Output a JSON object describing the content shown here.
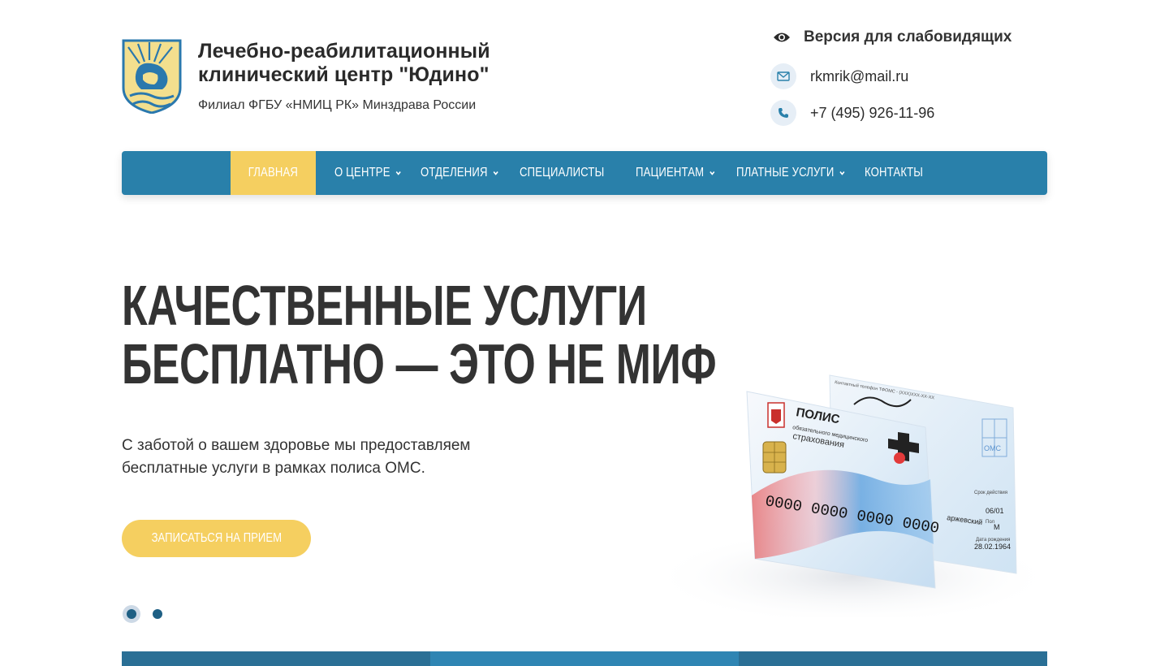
{
  "header": {
    "org_name_line1": "Лечебно-реабилитационный",
    "org_name_line2": "клинический центр \"Юдино\"",
    "org_subtitle": "Филиал ФГБУ «НМИЦ РК» Минздрава России",
    "vision_label": "Версия для слабовидящих",
    "vision_icon": "eye-icon",
    "email": "rkmrik@mail.ru",
    "email_icon": "envelope-icon",
    "phone": "+7 (495) 926-11-96",
    "phone_icon": "phone-icon"
  },
  "nav": {
    "items": [
      {
        "label": "ГЛАВНАЯ",
        "active": true,
        "has_submenu": false
      },
      {
        "label": "О ЦЕНТРЕ",
        "active": false,
        "has_submenu": true
      },
      {
        "label": "ОТДЕЛЕНИЯ",
        "active": false,
        "has_submenu": true
      },
      {
        "label": "СПЕЦИАЛИСТЫ",
        "active": false,
        "has_submenu": false
      },
      {
        "label": "ПАЦИЕНТАМ",
        "active": false,
        "has_submenu": true
      },
      {
        "label": "ПЛАТНЫЕ УСЛУГИ",
        "active": false,
        "has_submenu": true
      },
      {
        "label": "КОНТАКТЫ",
        "active": false,
        "has_submenu": false
      }
    ]
  },
  "hero": {
    "title_line1": "КАЧЕСТВЕННЫЕ УСЛУГИ",
    "title_line2": "БЕСПЛАТНО — ЭТО НЕ МИФ",
    "text_line1": "С заботой о вашем здоровье мы предоставляем",
    "text_line2": "бесплатные услуги в рамках полиса ОМС.",
    "cta_label": "ЗАПИСАТЬСЯ НА ПРИЕМ",
    "slides_count": 2,
    "active_slide": 1,
    "card": {
      "title": "ПОЛИС",
      "subtitle_line1": "обязательного медицинского",
      "subtitle_line2": "страхования",
      "number": "0000 0000 0000 0000",
      "back_phone": "Контактный телефон ТФОМС - (XXX)XXX-XX-XX",
      "back_oms": "ОМС",
      "back_valid_label": "Срок действия",
      "back_valid": "06/01",
      "back_sex_label": "Пол",
      "back_sex": "М",
      "back_dob_label": "Дата рождения",
      "back_dob": "28.02.1964",
      "back_name": "аржевский"
    }
  },
  "colors": {
    "primary": "#2980aa",
    "accent": "#f5cf60",
    "text": "#333333",
    "dot": "#1e5f84"
  }
}
